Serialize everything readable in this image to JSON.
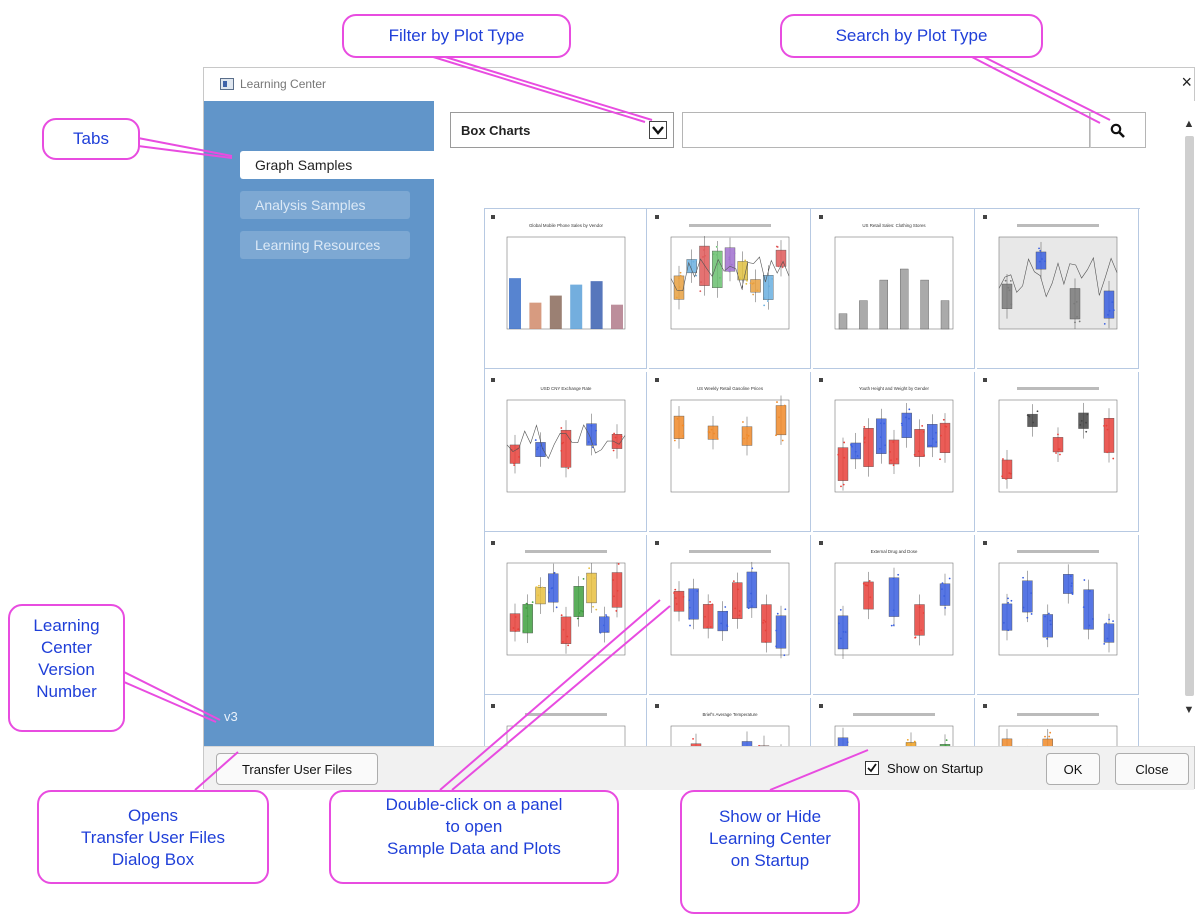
{
  "window": {
    "title": "Learning Center",
    "close_glyph": "×"
  },
  "sidebar": {
    "tabs": [
      {
        "label": "Graph Samples",
        "active": true
      },
      {
        "label": "Analysis Samples",
        "active": false
      },
      {
        "label": "Learning Resources",
        "active": false
      }
    ],
    "version": "v3"
  },
  "toolbar": {
    "filter_value": "Box Charts",
    "search_value": "",
    "search_icon": "magnifier-icon",
    "dropdown_icon": "chevron-down-icon"
  },
  "thumbnails": [
    {
      "title": "Global Mobile Phone Sales by Vendor"
    },
    {
      "title": ""
    },
    {
      "title": "US Retail Sales: Clothing Stores"
    },
    {
      "title": ""
    },
    {
      "title": "USD CNY Exchange Rate"
    },
    {
      "title": "US Weekly Retail Gasoline Prices"
    },
    {
      "title": "Youth Height and Weight by Gender"
    },
    {
      "title": ""
    },
    {
      "title": ""
    },
    {
      "title": ""
    },
    {
      "title": "External Drug and Dose"
    },
    {
      "title": ""
    },
    {
      "title": ""
    },
    {
      "title": "Brief's Average Temperature"
    },
    {
      "title": ""
    },
    {
      "title": ""
    }
  ],
  "footer": {
    "transfer_label": "Transfer User Files",
    "startup_label": "Show on Startup",
    "startup_checked": true,
    "ok_label": "OK",
    "close_label": "Close"
  },
  "callouts": {
    "filter": "Filter by Plot Type",
    "search": "Search by Plot Type",
    "tabs": "Tabs",
    "version": [
      "Learning",
      "Center",
      "Version",
      "Number"
    ],
    "transfer": [
      "Opens",
      "Transfer User Files",
      "Dialog Box"
    ],
    "double_click": [
      "Double-click on a panel",
      "to open",
      "Sample Data and Plots"
    ],
    "startup": [
      "Show or Hide",
      "Learning Center",
      "on Startup"
    ]
  },
  "colors": {
    "sidebar": "#6195c9",
    "callout_border": "#e84ce0",
    "callout_text": "#1f3fd8",
    "box_red": "#e8403a",
    "box_blue": "#3a5fe0",
    "box_orange": "#f08a2a"
  }
}
